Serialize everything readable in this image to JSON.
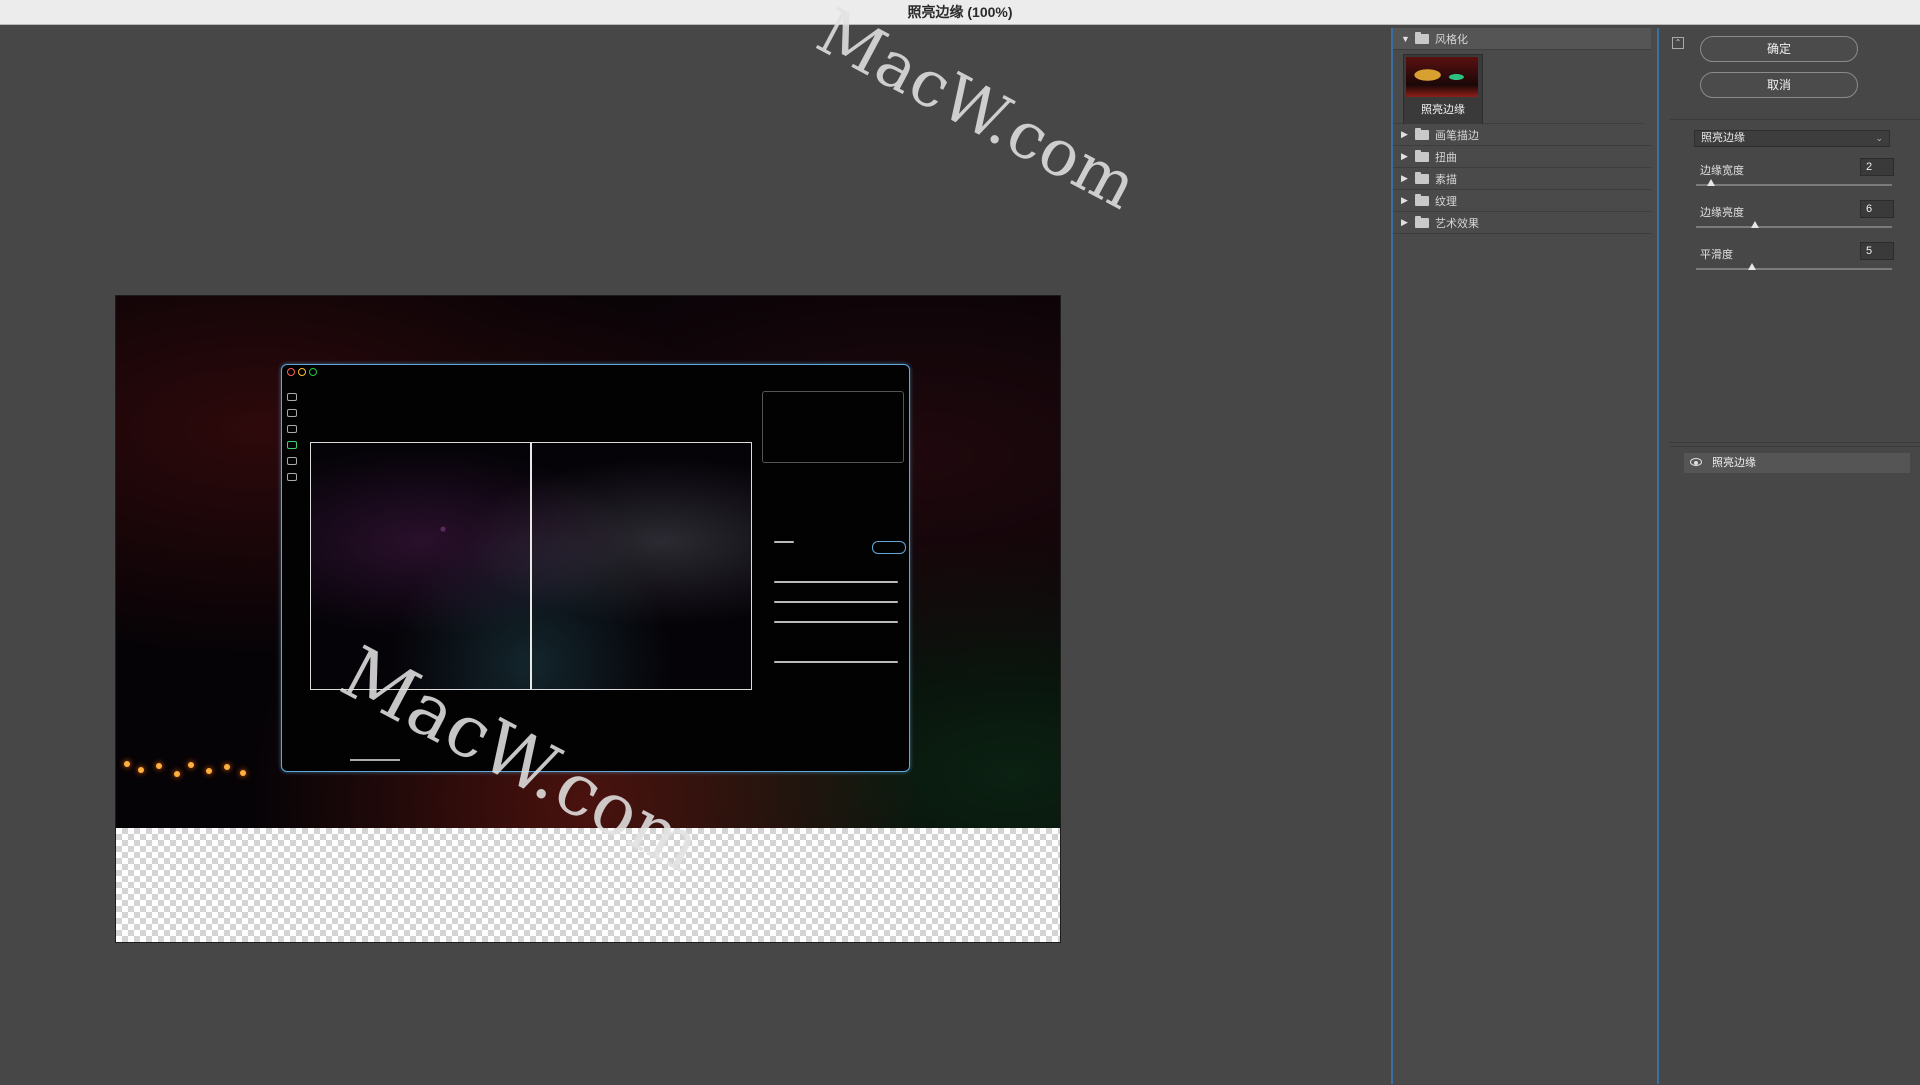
{
  "window": {
    "title": "照亮边缘 (100%)"
  },
  "watermark": "MacW.com",
  "filter_gallery": {
    "categories": [
      {
        "label": "风格化",
        "expanded": true
      },
      {
        "label": "画笔描边",
        "expanded": false
      },
      {
        "label": "扭曲",
        "expanded": false
      },
      {
        "label": "素描",
        "expanded": false
      },
      {
        "label": "纹理",
        "expanded": false
      },
      {
        "label": "艺术效果",
        "expanded": false
      }
    ],
    "selected_thumb": {
      "label": "照亮边缘"
    }
  },
  "actions": {
    "ok_label": "确定",
    "cancel_label": "取消"
  },
  "filter_options": {
    "selected_filter": "照亮边缘",
    "params": [
      {
        "label": "边缘宽度",
        "value": "2",
        "min": 1,
        "max": 14,
        "level": 2
      },
      {
        "label": "边缘亮度",
        "value": "6",
        "min": 0,
        "max": 20,
        "level": 6
      },
      {
        "label": "平滑度",
        "value": "5",
        "min": 1,
        "max": 15,
        "level": 5
      }
    ]
  },
  "effect_layers": [
    {
      "label": "照亮边缘",
      "visible": true
    }
  ],
  "colors": {
    "accent_border": "#3b6fa0",
    "panel_bg": "#474747"
  }
}
